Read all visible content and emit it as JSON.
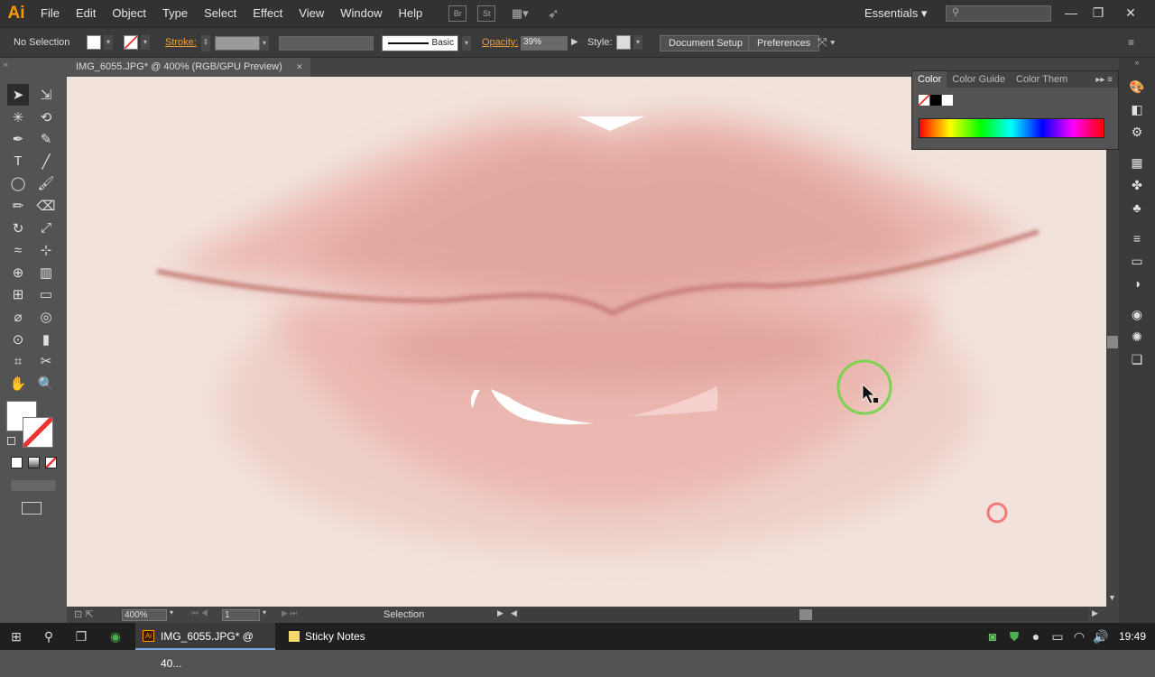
{
  "app": {
    "logo": "Ai",
    "accent": "#ff9a00"
  },
  "menu": [
    "File",
    "Edit",
    "Object",
    "Type",
    "Select",
    "Effect",
    "View",
    "Window",
    "Help"
  ],
  "menubar_icons": [
    {
      "name": "bridge-icon",
      "glyph": "Br"
    },
    {
      "name": "stock-icon",
      "glyph": "St"
    },
    {
      "name": "arrange-documents-icon",
      "glyph": "▦▾"
    },
    {
      "name": "gpu-performance-icon",
      "glyph": "➶"
    }
  ],
  "workspace": {
    "label": "Essentials"
  },
  "search": {
    "placeholder": ""
  },
  "window_buttons": [
    "—",
    "❐",
    "✕"
  ],
  "control_bar": {
    "selection_label": "No Selection",
    "stroke_label": "Stroke:",
    "stroke_profile": "Basic",
    "opacity_label": "Opacity:",
    "opacity_value": "39%",
    "style_label": "Style:",
    "document_setup": "Document Setup",
    "preferences": "Preferences"
  },
  "document_tab": {
    "title": "IMG_6055.JPG* @ 400% (RGB/GPU Preview)",
    "close": "✕"
  },
  "color_panel": {
    "tabs": [
      "Color",
      "Color Guide",
      "Color Them"
    ]
  },
  "tools": [
    [
      "selection-tool",
      "➤"
    ],
    [
      "direct-selection-tool",
      "⇲"
    ],
    [
      "magic-wand-tool",
      "✳"
    ],
    [
      "lasso-tool",
      "⟲"
    ],
    [
      "pen-tool",
      "✒"
    ],
    [
      "curvature-tool",
      "✎"
    ],
    [
      "type-tool",
      "T"
    ],
    [
      "line-tool",
      "╱"
    ],
    [
      "ellipse-tool",
      "◯"
    ],
    [
      "paintbrush-tool",
      "🖌"
    ],
    [
      "pencil-tool",
      "✏"
    ],
    [
      "eraser-tool",
      "⌫"
    ],
    [
      "rotate-tool",
      "↻"
    ],
    [
      "scale-tool",
      "⤢"
    ],
    [
      "width-tool",
      "≈"
    ],
    [
      "free-transform-tool",
      "⊹"
    ],
    [
      "shape-builder-tool",
      "⊕"
    ],
    [
      "perspective-grid-tool",
      "▥"
    ],
    [
      "mesh-tool",
      "⊞"
    ],
    [
      "gradient-tool",
      "▭"
    ],
    [
      "eyedropper-tool",
      "⌀"
    ],
    [
      "blend-tool",
      "◎"
    ],
    [
      "symbol-sprayer-tool",
      "⊙"
    ],
    [
      "column-graph-tool",
      "▮"
    ],
    [
      "artboard-tool",
      "⌗"
    ],
    [
      "slice-tool",
      "✂"
    ],
    [
      "hand-tool",
      "✋"
    ],
    [
      "zoom-tool",
      "🔍"
    ]
  ],
  "status": {
    "zoom": "400%",
    "page": "1",
    "tool": "Selection"
  },
  "taskbar": {
    "apps": [
      {
        "label": "IMG_6055.JPG* @ 40..."
      },
      {
        "label": "Sticky Notes"
      }
    ],
    "clock": "19:49"
  },
  "colors": {
    "canvas": "#f2e2dc",
    "lip": "#e8aaa2",
    "lip_line": "#c97f78",
    "cursor_ring": "#7bd34f",
    "click_ring": "#f07a78"
  }
}
